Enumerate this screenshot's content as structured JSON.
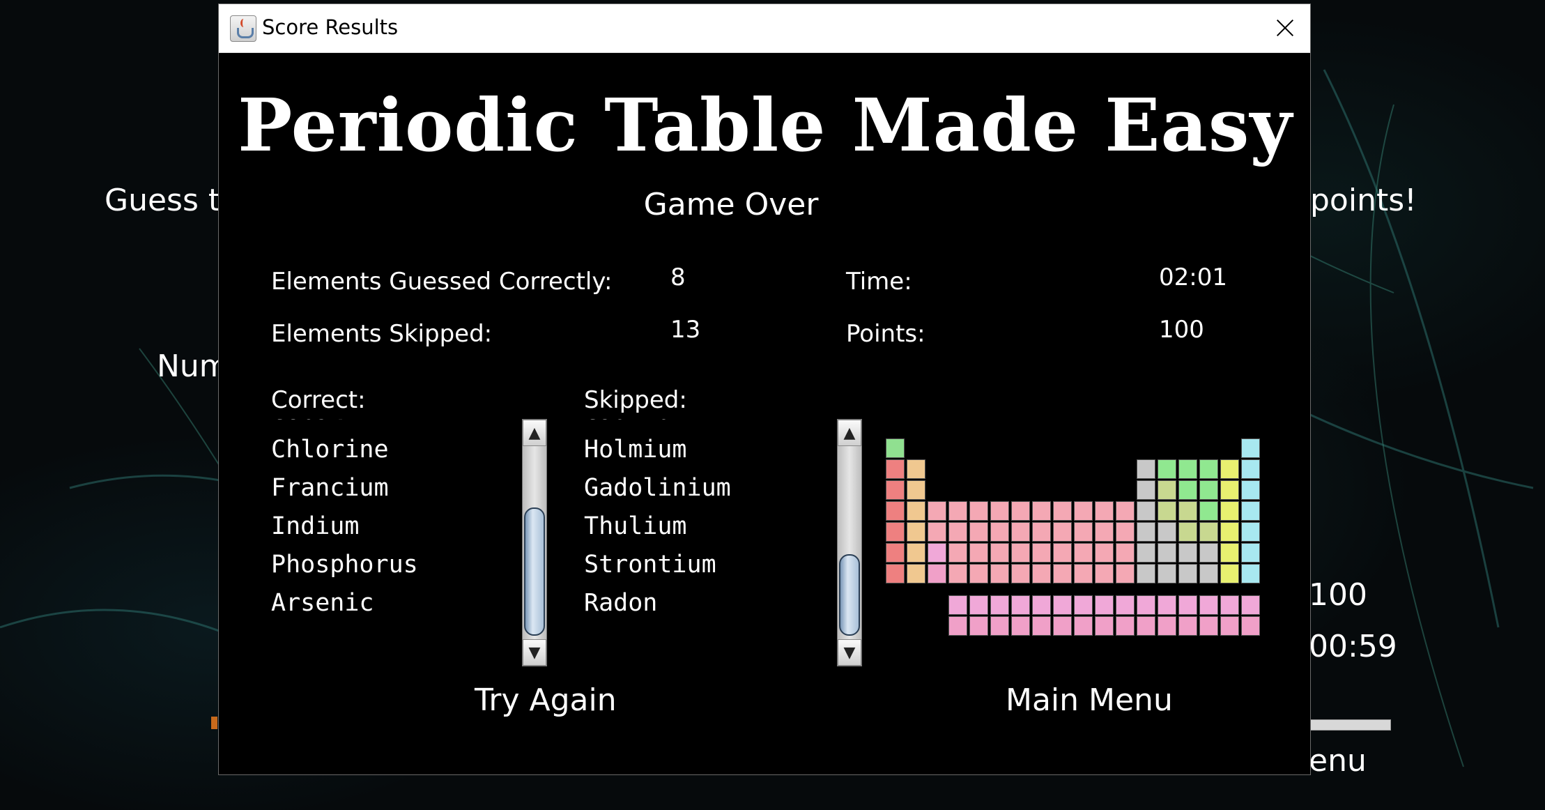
{
  "background": {
    "guess_text": "Guess th",
    "points_text": "points!",
    "num_text": "Num",
    "score_value": "100",
    "time_value": "00:59",
    "menu_text": "enu"
  },
  "dialog": {
    "title": "Score Results",
    "heading": "Periodic Table Made Easy",
    "subtitle": "Game Over",
    "stats": {
      "correct_label": "Elements Guessed Correctly:",
      "correct_value": "8",
      "skipped_label": "Elements Skipped:",
      "skipped_value": "13",
      "time_label": "Time:",
      "time_value": "02:01",
      "points_label": "Points:",
      "points_value": "100"
    },
    "correct_list": {
      "label": "Correct:",
      "items": [
        "Cobalt",
        "Chlorine",
        "Francium",
        "Indium",
        "Phosphorus",
        "Arsenic"
      ]
    },
    "skipped_list": {
      "label": "Skipped:",
      "items": [
        "Cadmium",
        "Holmium",
        "Gadolinium",
        "Thulium",
        "Strontium",
        "Radon"
      ]
    },
    "try_again_label": "Try Again",
    "main_menu_label": "Main Menu",
    "colors": {
      "alkali": "#ee8080",
      "alkaline": "#f0c890",
      "transition": "#f4a8b4",
      "metal": "#c8c8c8",
      "metalloid": "#c8d890",
      "nonmetal": "#90e890",
      "halogen": "#e8f070",
      "noble": "#a8e8f0",
      "lanthanide": "#f0a8d8",
      "actinide": "#f0a0c8",
      "hydrogen": "#90e090"
    }
  }
}
